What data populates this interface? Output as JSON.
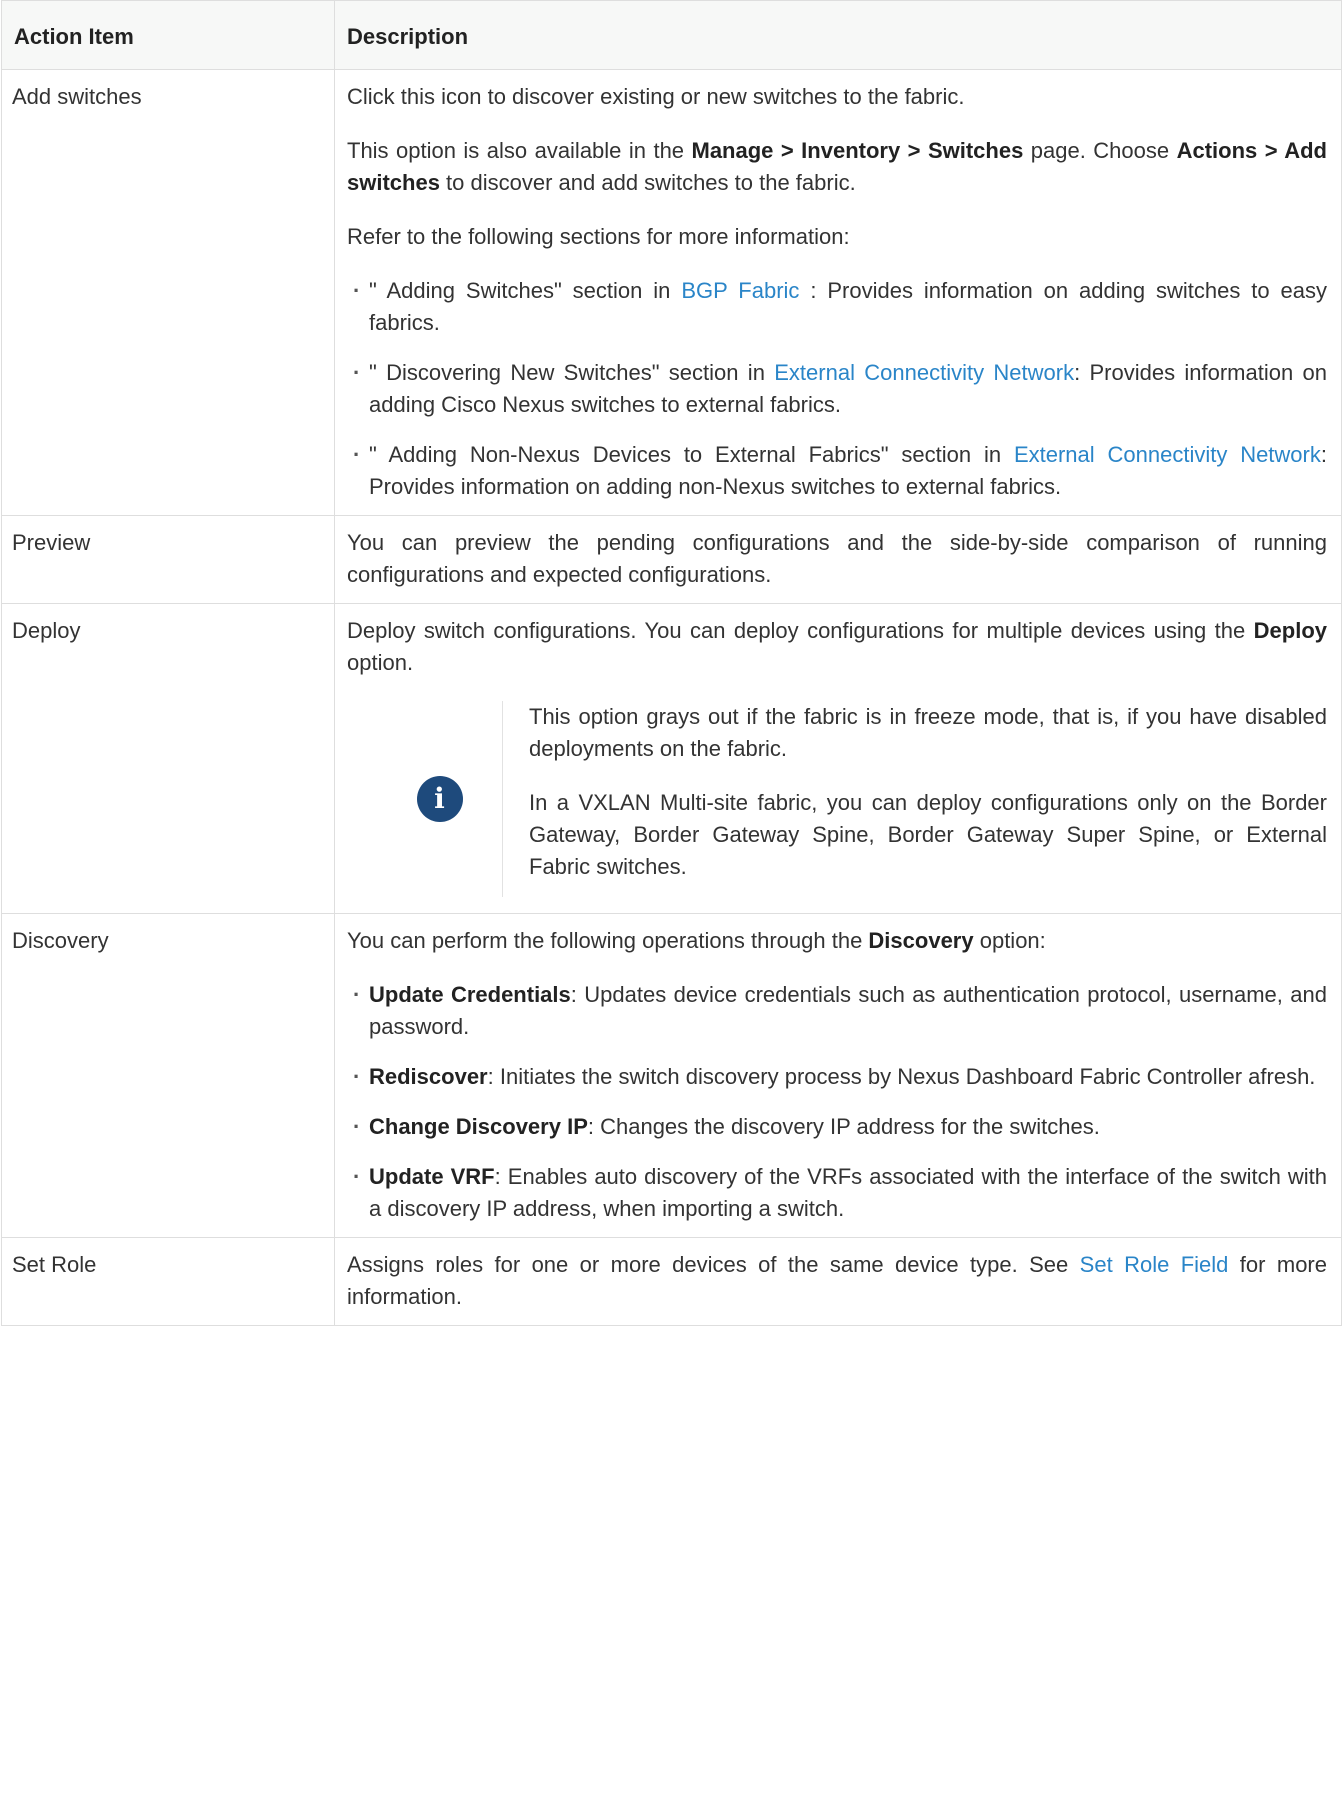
{
  "table": {
    "headers": {
      "action": "Action Item",
      "description": "Description"
    },
    "add_switches": {
      "action": "Add switches",
      "p1": "Click this icon to discover existing or new switches to the fabric.",
      "p2_pre": "This option is also available in the ",
      "p2_bold1": "Manage > Inventory > Switches",
      "p2_mid": " page. Choose ",
      "p2_bold2": "Actions > Add switches",
      "p2_post": " to discover and add switches to the fabric.",
      "p3": "Refer to the following sections for more information:",
      "bullets": [
        {
          "pre": "\" Adding Switches\" section in ",
          "link": "BGP Fabric",
          "post": " : Provides information on adding switches to easy fabrics."
        },
        {
          "pre": "\" Discovering New Switches\" section in ",
          "link": "External Connectivity Network",
          "post": ": Provides information on adding Cisco Nexus switches to external fabrics."
        },
        {
          "pre": "\" Adding Non-Nexus Devices to External Fabrics\" section in ",
          "link": "External Connectivity Network",
          "post": ": Provides information on adding non-Nexus switches to external fabrics."
        }
      ]
    },
    "preview": {
      "action": "Preview",
      "desc": "You can preview the pending configurations and the side-by-side comparison of running configurations and expected configurations."
    },
    "deploy": {
      "action": "Deploy",
      "desc_pre": "Deploy switch configurations. You can deploy configurations for multiple devices using the ",
      "desc_bold": "Deploy",
      "desc_post": " option.",
      "note_icon": "info-icon",
      "note_p1": "This option grays out if the fabric is in freeze mode, that is, if you have disabled deployments on the fabric.",
      "note_p2": "In a VXLAN Multi-site fabric, you can deploy configurations only on the Border Gateway, Border Gateway Spine, Border Gateway Super Spine, or External Fabric switches."
    },
    "discovery": {
      "action": "Discovery",
      "intro_pre": "You can perform the following operations through the ",
      "intro_bold": "Discovery",
      "intro_post": " option:",
      "bullets": [
        {
          "bold": "Update Credentials",
          "text": ": Updates device credentials such as authentication protocol, username, and password."
        },
        {
          "bold": "Rediscover",
          "text": ": Initiates the switch discovery process by Nexus Dashboard Fabric Controller afresh."
        },
        {
          "bold": "Change Discovery IP",
          "text": ": Changes the discovery IP address for the switches."
        },
        {
          "bold": "Update VRF",
          "text": ": Enables auto discovery of the VRFs associated with the interface of the switch with a discovery IP address, when importing a switch."
        }
      ]
    },
    "set_role": {
      "action": "Set Role",
      "desc_pre": "Assigns roles for one or more devices of the same device type. See ",
      "desc_link": "Set Role Field",
      "desc_post": " for more information."
    }
  },
  "colors": {
    "link": "#2a85c8",
    "header_bg": "#f7f8f7",
    "border": "#dedede",
    "info_icon": "#1e4a7c"
  }
}
